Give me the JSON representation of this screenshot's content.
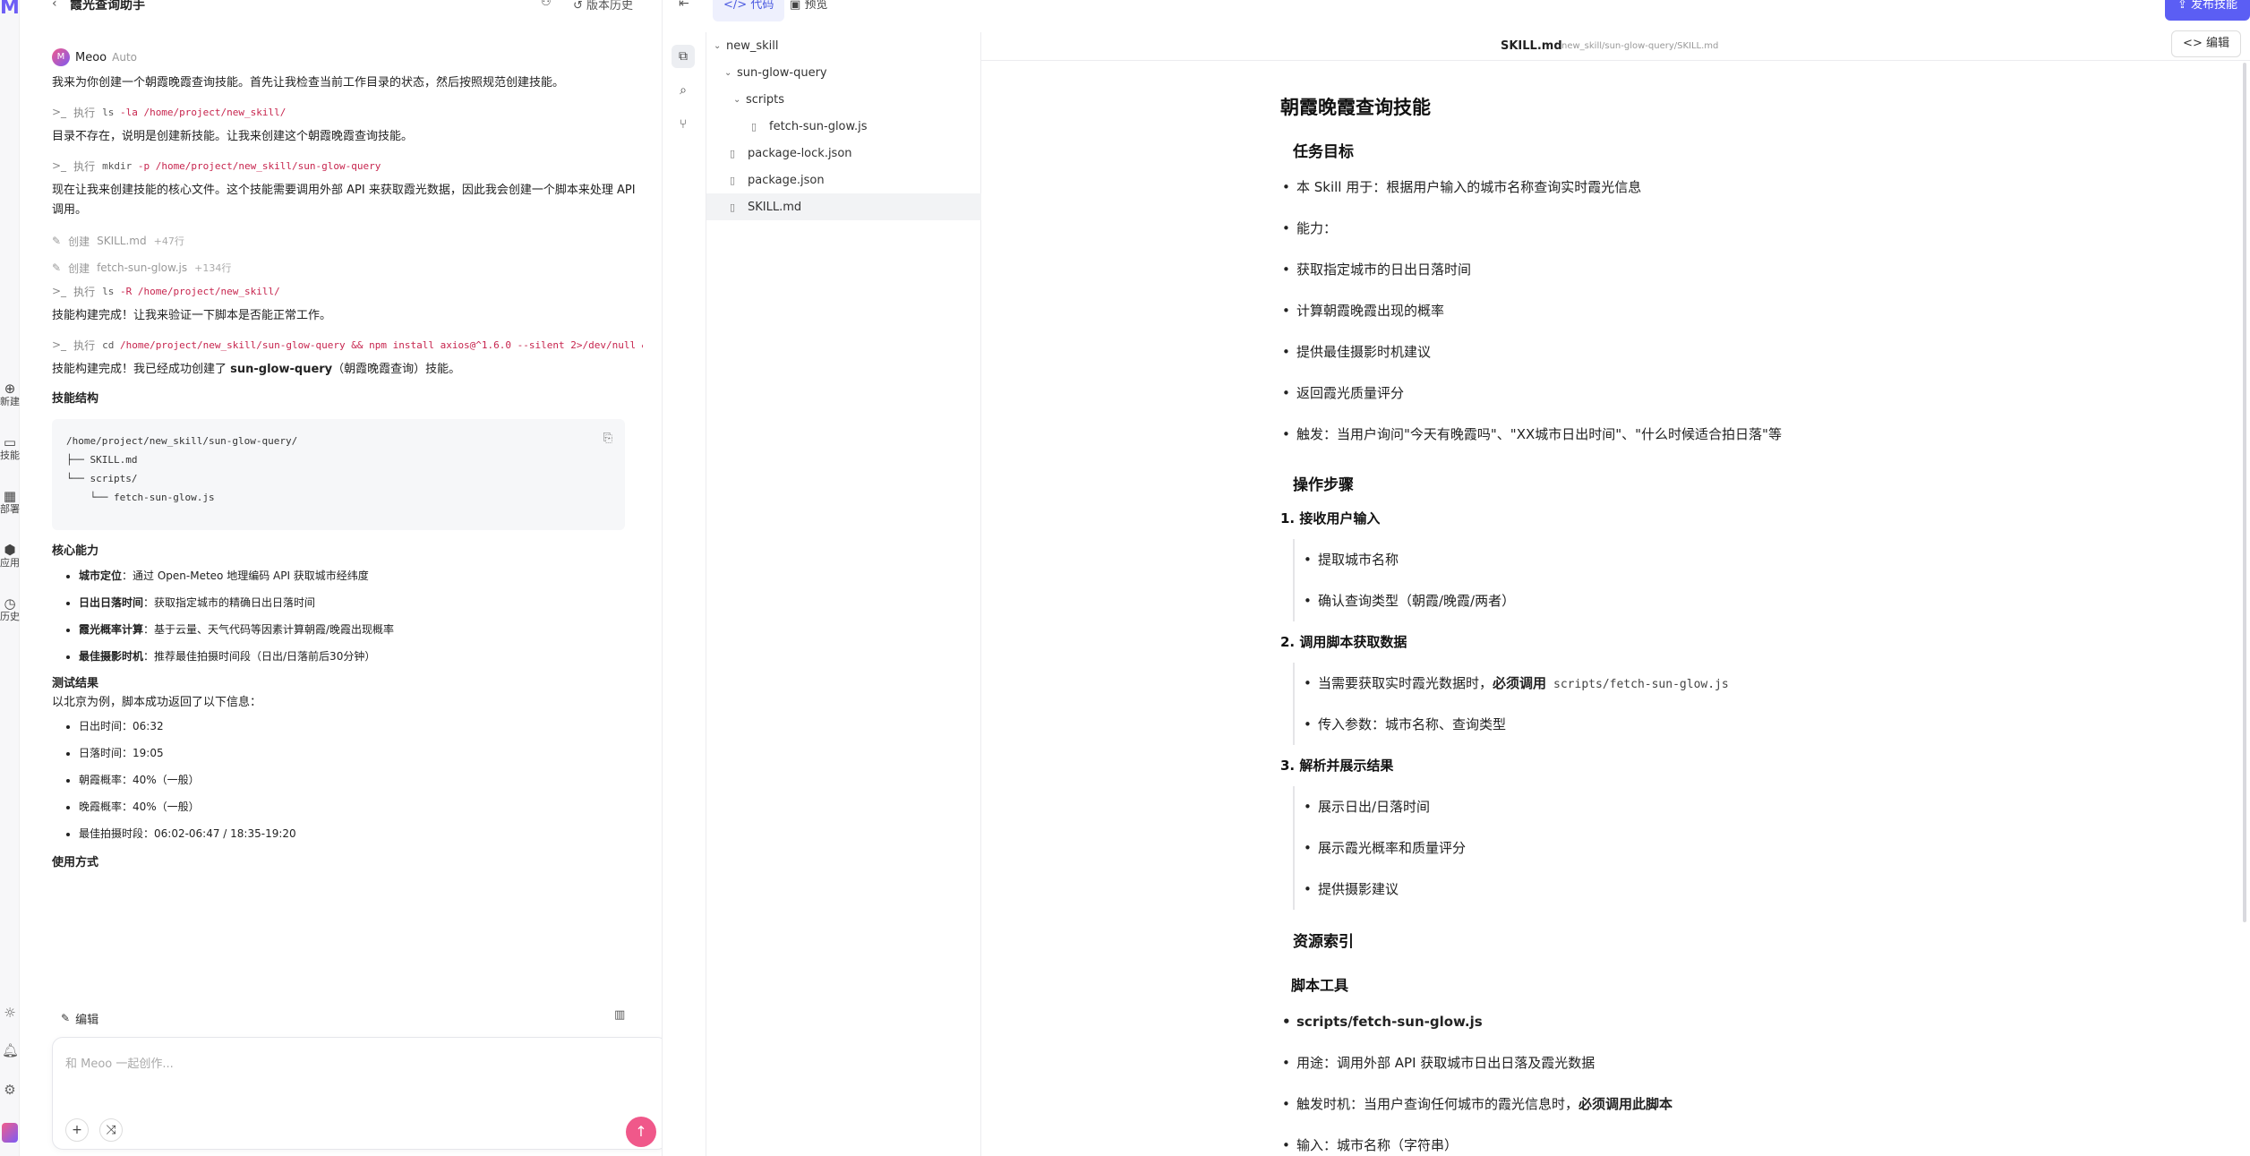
{
  "rail": {
    "logo": "M",
    "items": [
      {
        "icon": "plus-circle-icon",
        "label": "新建"
      },
      {
        "icon": "inbox-icon",
        "label": "技能"
      },
      {
        "icon": "grid-icon",
        "label": "部署"
      },
      {
        "icon": "cube-icon",
        "label": "应用"
      },
      {
        "icon": "clock-icon",
        "label": "历史"
      }
    ]
  },
  "chat": {
    "title": "霞光查询助手",
    "actions": {
      "share_icon": "user-share-icon",
      "history_label": "版本历史"
    },
    "assistant": {
      "name": "Meoo",
      "mode": "Auto"
    },
    "messages": {
      "p1": "我来为你创建一个朝霞晚霞查询技能。首先让我检查当前工作目录的状态，然后按照规范创建技能。",
      "cmd1": {
        "label": "执行",
        "name": "ls",
        "args": "-la /home/project/new_skill/"
      },
      "p2": "目录不存在，说明是创建新技能。让我来创建这个朝霞晚霞查询技能。",
      "cmd2": {
        "label": "执行",
        "name": "mkdir",
        "args": "-p /home/project/new_skill/sun-glow-query"
      },
      "p3": "现在让我来创建技能的核心文件。这个技能需要调用外部 API 来获取霞光数据，因此我会创建一个脚本来处理 API 调用。",
      "file1": {
        "label": "创建",
        "file": "SKILL.md",
        "count": "+47行"
      },
      "file2": {
        "label": "创建",
        "file": "fetch-sun-glow.js",
        "count": "+134行"
      },
      "cmd3": {
        "label": "执行",
        "name": "ls",
        "args": "-R /home/project/new_skill/"
      },
      "p4": "技能构建完成！让我来验证一下脚本是否能正常工作。",
      "cmd4": {
        "label": "执行",
        "name": "cd",
        "args": "/home/project/new_skill/sun-glow-query && npm install axios@^1.6.0 --silent 2>/dev/null &&",
        "more": "···"
      },
      "p5_pre": "技能构建完成！我已经成功创建了 ",
      "p5_bold": "sun-glow-query",
      "p5_post": "（朝霞晚霞查询）技能。",
      "structure_title": "技能结构",
      "structure_code": "/home/project/new_skill/sun-glow-query/\n├── SKILL.md\n└── scripts/\n    └── fetch-sun-glow.js",
      "abilities_title": "核心能力",
      "abilities": [
        {
          "bold": "城市定位",
          "text": "：通过 Open-Meteo 地理编码 API 获取城市经纬度"
        },
        {
          "bold": "日出日落时间",
          "text": "：获取指定城市的精确日出日落时间"
        },
        {
          "bold": "霞光概率计算",
          "text": "：基于云量、天气代码等因素计算朝霞/晚霞出现概率"
        },
        {
          "bold": "最佳摄影时机",
          "text": "：推荐最佳拍摄时间段（日出/日落前后30分钟）"
        }
      ],
      "test_title": "测试结果",
      "test_intro": "以北京为例，脚本成功返回了以下信息：",
      "test_items": [
        "日出时间：06:32",
        "日落时间：19:05",
        "朝霞概率：40%（一般）",
        "晚霞概率：40%（一般）",
        "最佳拍摄时段：06:02-06:47 / 18:35-19:20"
      ],
      "usage_title": "使用方式"
    },
    "composer": {
      "tool_label": "编辑",
      "placeholder": "和 Meoo 一起创作...",
      "add_icon": "plus-icon",
      "shuffle_icon": "shuffle-icon",
      "send_icon": "send-arrow-icon"
    }
  },
  "editor": {
    "tabs": [
      {
        "label": "代码",
        "active": true
      },
      {
        "label": "预览",
        "active": false
      }
    ],
    "publish_label": "发布技能",
    "tree": [
      {
        "label": "new_skill",
        "type": "folder",
        "depth": 0
      },
      {
        "label": "sun-glow-query",
        "type": "folder",
        "depth": 1
      },
      {
        "label": "scripts",
        "type": "folder",
        "depth": 2
      },
      {
        "label": "fetch-sun-glow.js",
        "type": "file",
        "depth": 3
      },
      {
        "label": "package-lock.json",
        "type": "file",
        "depth": 2
      },
      {
        "label": "package.json",
        "type": "file",
        "depth": 2
      },
      {
        "label": "SKILL.md",
        "type": "file",
        "depth": 2,
        "selected": true
      }
    ],
    "doc_name": "SKILL.md",
    "doc_path": "new_skill/sun-glow-query/SKILL.md",
    "edit_label": "编辑",
    "doc": {
      "h1": "朝霞晚霞查询技能",
      "h2_goal": "任务目标",
      "goal_items": [
        "本 Skill 用于：根据用户输入的城市名称查询实时霞光信息",
        "能力：",
        "获取指定城市的日出日落时间",
        "计算朝霞晚霞出现的概率",
        "提供最佳摄影时机建议",
        "返回霞光质量评分",
        "触发：当用户询问\"今天有晚霞吗\"、\"XX城市日出时间\"、\"什么时候适合拍日落\"等"
      ],
      "h2_steps": "操作步骤",
      "step1": "1.  接收用户输入",
      "step1_items": [
        "提取城市名称",
        "确认查询类型（朝霞/晚霞/两者）"
      ],
      "step2": "2.  调用脚本获取数据",
      "step2_item1_pre": "当需要获取实时霞光数据时，",
      "step2_item1_bold": "必须调用",
      "step2_item1_code": "scripts/fetch-sun-glow.js",
      "step2_item2": "传入参数：城市名称、查询类型",
      "step3": "3.  解析并展示结果",
      "step3_items": [
        "展示日出/日落时间",
        "展示霞光概率和质量评分",
        "提供摄影建议"
      ],
      "h2_resources": "资源索引",
      "h3_tools": "脚本工具",
      "tool_items": {
        "name": "scripts/fetch-sun-glow.js",
        "purpose": "用途：调用外部 API 获取城市日出日落及霞光数据",
        "timing_pre": "触发时机：当用户查询任何城市的霞光信息时，",
        "timing_bold": "必须调用此脚本",
        "input": "输入：城市名称（字符串）"
      }
    }
  }
}
